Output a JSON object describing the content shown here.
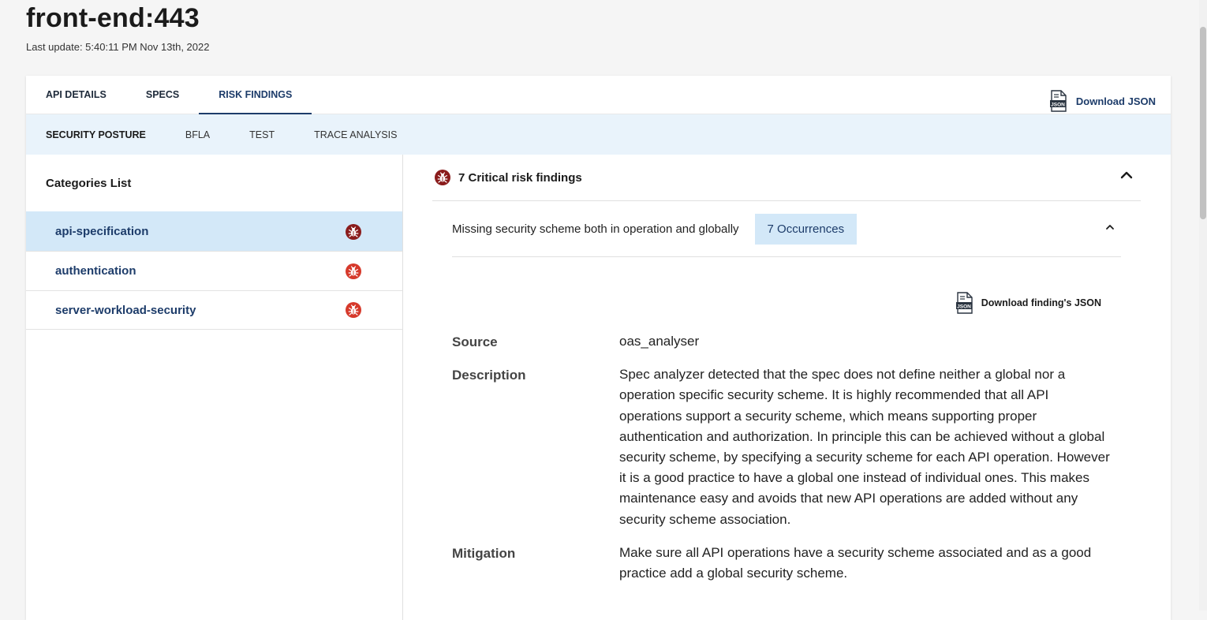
{
  "header": {
    "title": "front-end:443",
    "last_update": "Last update: 5:40:11 PM Nov 13th, 2022"
  },
  "main_tabs": [
    {
      "label": "API DETAILS",
      "active": false
    },
    {
      "label": "SPECS",
      "active": false
    },
    {
      "label": "RISK FINDINGS",
      "active": true
    }
  ],
  "download_json": {
    "label": "Download JSON",
    "icon": "json-file-icon",
    "icon_text": "JSON"
  },
  "sub_tabs": [
    {
      "label": "SECURITY POSTURE",
      "active": true
    },
    {
      "label": "BFLA",
      "active": false
    },
    {
      "label": "TEST",
      "active": false
    },
    {
      "label": "TRACE ANALYSIS",
      "active": false
    }
  ],
  "categories": {
    "header": "Categories List",
    "items": [
      {
        "label": "api-specification",
        "icon": "bug-icon",
        "selected": true
      },
      {
        "label": "authentication",
        "icon": "bug-icon",
        "selected": false
      },
      {
        "label": "server-workload-security",
        "icon": "bug-icon",
        "selected": false
      }
    ]
  },
  "risk": {
    "header": "7 Critical risk findings",
    "finding": {
      "title": "Missing security scheme both in operation and globally",
      "occurrences": "7 Occurrences",
      "download_label": "Download finding's JSON",
      "source_label": "Source",
      "source_value": "oas_analyser",
      "description_label": "Description",
      "description_value": "Spec analyzer detected that the spec does not define neither a global nor a operation specific security scheme. It is highly recommended that all API operations support a security scheme, which means supporting proper authentication and authorization. In principle this can be achieved without a global security scheme, by specifying a security scheme for each API operation. However it is a good practice to have a global one instead of individual ones. This makes maintenance easy and avoids that new API operations are added without any security scheme association.",
      "mitigation_label": "Mitigation",
      "mitigation_value": "Make sure all API operations have a security scheme associated and as a good practice add a global security scheme."
    }
  },
  "colors": {
    "accent": "#1d3c6a",
    "selected_bg": "#d3e8f8",
    "subtab_bg": "#e9f3fb",
    "critical_dark": "#8a1c1c",
    "critical_red": "#d6392b"
  }
}
